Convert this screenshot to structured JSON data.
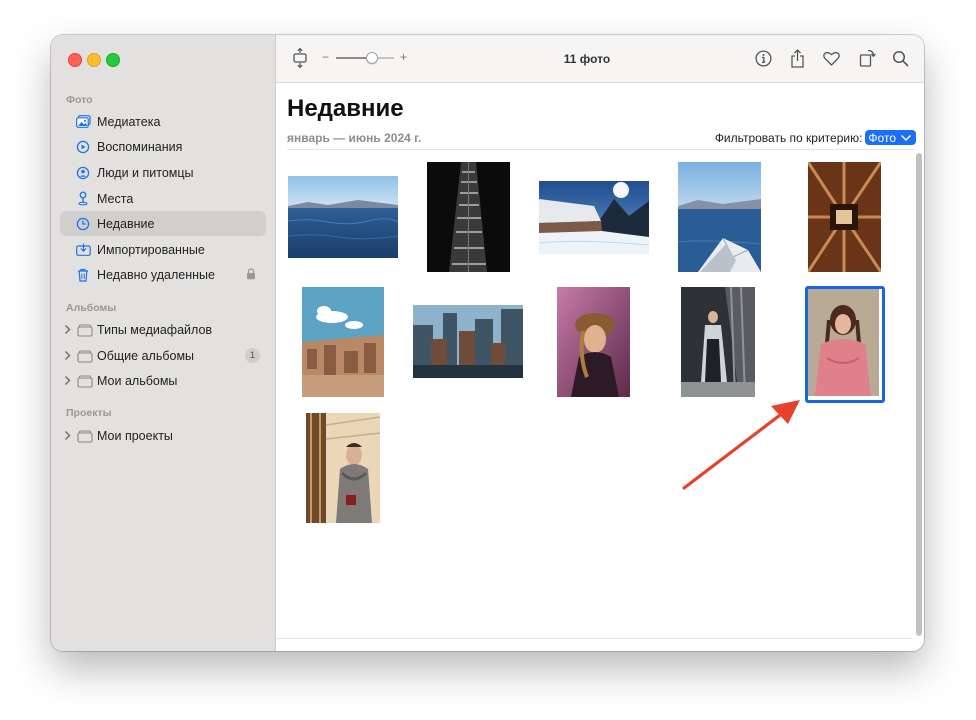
{
  "window": {
    "photo_count": "11 фото"
  },
  "sidebar": {
    "sections": [
      {
        "title": "Фото",
        "items": [
          {
            "label": "Медиатека",
            "icon": "photo-library-icon"
          },
          {
            "label": "Воспоминания",
            "icon": "memories-icon"
          },
          {
            "label": "Люди и питомцы",
            "icon": "people-icon"
          },
          {
            "label": "Места",
            "icon": "places-icon"
          },
          {
            "label": "Недавние",
            "icon": "recents-icon",
            "selected": true
          },
          {
            "label": "Импортированные",
            "icon": "imports-icon"
          },
          {
            "label": "Недавно удаленные",
            "icon": "trash-icon",
            "locked": true
          }
        ]
      },
      {
        "title": "Альбомы",
        "items": [
          {
            "label": "Типы медиафайлов",
            "icon": "folder-icon"
          },
          {
            "label": "Общие альбомы",
            "icon": "folder-icon",
            "badge": "1"
          },
          {
            "label": "Мои альбомы",
            "icon": "folder-icon"
          }
        ]
      },
      {
        "title": "Проекты",
        "items": [
          {
            "label": "Мои проекты",
            "icon": "folder-icon"
          }
        ]
      }
    ]
  },
  "toolbar": {
    "zoom_minus": "−",
    "zoom_plus": "+",
    "zoom_level": 0.6,
    "icons": [
      "info-icon",
      "share-icon",
      "favorite-icon",
      "rotate-icon",
      "search-icon"
    ]
  },
  "main": {
    "title": "Недавние",
    "date_range": "январь — июнь 2024 г.",
    "filter_label": "Фильтровать по критерию:",
    "filter_value": "Фото",
    "photos": [
      {
        "subject": "sea-horizon"
      },
      {
        "subject": "skyscraper-lookup"
      },
      {
        "subject": "snowy-landscape"
      },
      {
        "subject": "boat-sea"
      },
      {
        "subject": "wooden-corridor"
      },
      {
        "subject": "city-rooftops"
      },
      {
        "subject": "city-buildings"
      },
      {
        "subject": "portrait-woman-hat"
      },
      {
        "subject": "woman-in-coat-stairs"
      },
      {
        "subject": "woman-pink-outfit",
        "selected": true
      },
      {
        "subject": "woman-grey-scarf"
      }
    ]
  },
  "colors": {
    "accent": "#1a6ef7",
    "annotation_arrow": "#e8412b"
  }
}
